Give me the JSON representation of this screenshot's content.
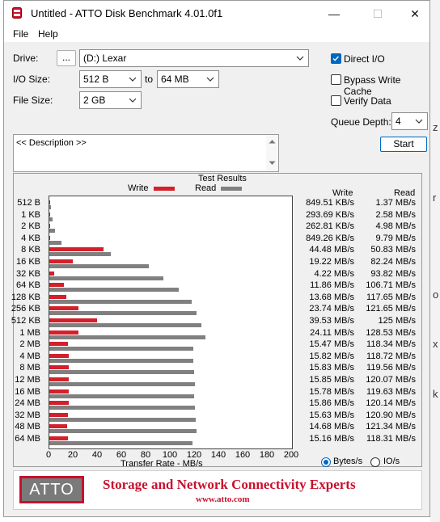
{
  "window": {
    "title": "Untitled - ATTO Disk Benchmark 4.01.0f1",
    "minimize": "—",
    "maximize": "☐",
    "close": "✕"
  },
  "menu": [
    "File",
    "Help"
  ],
  "settings": {
    "drive_label": "Drive:",
    "browse_label": "...",
    "drive_value": "(D:) Lexar",
    "io_size_label": "I/O Size:",
    "io_from": "512 B",
    "to_label": "to",
    "io_to": "64 MB",
    "file_size_label": "File Size:",
    "file_size": "2 GB",
    "direct_io": "Direct I/O",
    "direct_io_checked": true,
    "bypass_cache": "Bypass Write Cache",
    "bypass_cache_checked": false,
    "verify_data": "Verify Data",
    "verify_data_checked": false,
    "queue_depth_label": "Queue Depth:",
    "queue_depth": "4",
    "start": "Start",
    "description": "<< Description >>"
  },
  "results": {
    "title": "Test Results",
    "write_legend": "Write",
    "read_legend": "Read",
    "write_header": "Write",
    "read_header": "Read",
    "write_color": "#d4202a",
    "read_color": "#808080",
    "x_axis_label": "Transfer Rate - MB/s",
    "units_bytes": "Bytes/s",
    "units_io": "IO/s",
    "units_selected": "Bytes/s"
  },
  "chart_data": {
    "type": "bar",
    "orientation": "horizontal",
    "xlabel": "Transfer Rate - MB/s",
    "xlim": [
      0,
      200
    ],
    "xticks": [
      0,
      20,
      40,
      60,
      80,
      100,
      120,
      140,
      160,
      180,
      200
    ],
    "categories": [
      "512 B",
      "1 KB",
      "2 KB",
      "4 KB",
      "8 KB",
      "16 KB",
      "32 KB",
      "64 KB",
      "128 KB",
      "256 KB",
      "512 KB",
      "1 MB",
      "2 MB",
      "4 MB",
      "8 MB",
      "12 MB",
      "16 MB",
      "24 MB",
      "32 MB",
      "48 MB",
      "64 MB"
    ],
    "series": [
      {
        "name": "Write",
        "values": [
          0.83,
          0.29,
          0.26,
          0.83,
          44.48,
          19.22,
          4.22,
          11.86,
          13.68,
          23.74,
          39.53,
          24.11,
          15.47,
          15.82,
          15.83,
          15.85,
          15.78,
          15.86,
          15.63,
          14.68,
          15.16
        ]
      },
      {
        "name": "Read",
        "values": [
          1.37,
          2.58,
          4.98,
          9.79,
          50.83,
          82.24,
          93.82,
          106.71,
          117.65,
          121.65,
          125,
          128.53,
          118.34,
          118.72,
          119.56,
          120.07,
          119.63,
          120.14,
          120.9,
          121.34,
          118.31
        ]
      }
    ],
    "write_text": [
      "849.51 KB/s",
      "293.69 KB/s",
      "262.81 KB/s",
      "849.26 KB/s",
      "44.48 MB/s",
      "19.22 MB/s",
      "4.22 MB/s",
      "11.86 MB/s",
      "13.68 MB/s",
      "23.74 MB/s",
      "39.53 MB/s",
      "24.11 MB/s",
      "15.47 MB/s",
      "15.82 MB/s",
      "15.83 MB/s",
      "15.85 MB/s",
      "15.78 MB/s",
      "15.86 MB/s",
      "15.63 MB/s",
      "14.68 MB/s",
      "15.16 MB/s"
    ],
    "read_text": [
      "1.37 MB/s",
      "2.58 MB/s",
      "4.98 MB/s",
      "9.79 MB/s",
      "50.83 MB/s",
      "82.24 MB/s",
      "93.82 MB/s",
      "106.71 MB/s",
      "117.65 MB/s",
      "121.65 MB/s",
      "125 MB/s",
      "128.53 MB/s",
      "118.34 MB/s",
      "118.72 MB/s",
      "119.56 MB/s",
      "120.07 MB/s",
      "119.63 MB/s",
      "120.14 MB/s",
      "120.90 MB/s",
      "121.34 MB/s",
      "118.31 MB/s"
    ]
  },
  "banner": {
    "logo": "ATTO",
    "tagline": "Storage and Network Connectivity Experts",
    "url": "www.atto.com"
  },
  "background": {
    "chars": [
      "z",
      "r",
      "o",
      "x",
      "k"
    ]
  }
}
